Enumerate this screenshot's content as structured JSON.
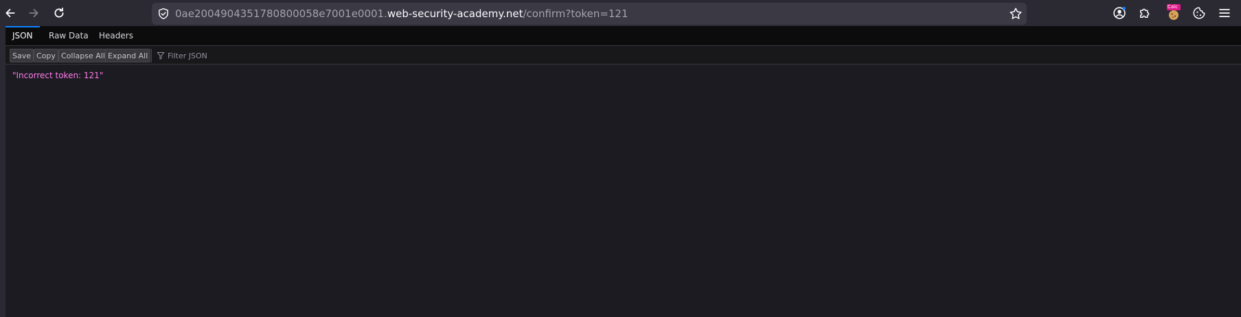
{
  "browser": {
    "url_prefix": "0ae2004904351780800058e7001e0001.",
    "url_host": "web-security-academy.net",
    "url_path": "/confirm?token=121",
    "extension_badge": "Calc"
  },
  "viewer": {
    "tabs": [
      {
        "label": "JSON",
        "active": true
      },
      {
        "label": "Raw Data",
        "active": false
      },
      {
        "label": "Headers",
        "active": false
      }
    ],
    "toolbar": {
      "save_label": "Save",
      "copy_label": "Copy",
      "collapse_label": "Collapse All",
      "expand_label": "Expand All",
      "filter_placeholder": "Filter JSON"
    },
    "content": {
      "value": "\"Incorrect token: 121\""
    }
  },
  "colors": {
    "accent": "#0a84ff",
    "string": "#ff7de9"
  }
}
